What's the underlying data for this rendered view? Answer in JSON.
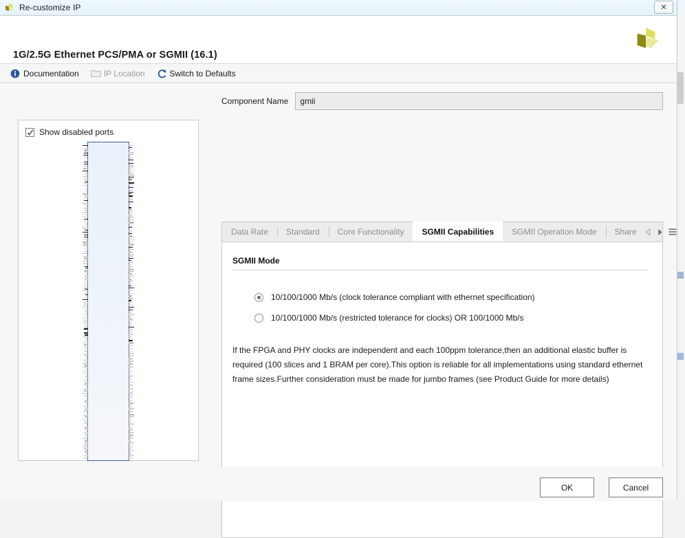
{
  "titlebar": {
    "title": "Re-customize IP",
    "logo_icon": "xilinx-logo-icon",
    "close_label": "✕"
  },
  "header": {
    "title": "1G/2.5G Ethernet PCS/PMA or SGMII (16.1)",
    "logo_icon": "xilinx-logo-icon"
  },
  "toolbar": {
    "items": [
      {
        "label": "Documentation",
        "icon": "info-icon",
        "enabled": true
      },
      {
        "label": "IP Location",
        "icon": "folder-icon",
        "enabled": false
      },
      {
        "label": "Switch to Defaults",
        "icon": "refresh-icon",
        "enabled": true
      }
    ]
  },
  "port_panel": {
    "show_disabled_ports_label": "Show disabled ports",
    "show_disabled_ports_checked": true,
    "symbol_name": "ip-block-symbol"
  },
  "component": {
    "label": "Component Name",
    "value": "gmii",
    "placeholder": "Component Name"
  },
  "tabs": {
    "items": [
      {
        "label": "Data Rate",
        "active": false
      },
      {
        "label": "Standard",
        "active": false
      },
      {
        "label": "Core Functionality",
        "active": false
      },
      {
        "label": "SGMII Capabilities",
        "active": true
      },
      {
        "label": "SGMII Operation Mode",
        "active": false
      },
      {
        "label": "Share",
        "active": false
      }
    ],
    "nav": {
      "prev_icon": "chevron-left-icon",
      "next_icon": "chevron-right-icon",
      "menu_icon": "hamburger-menu-icon"
    }
  },
  "panel": {
    "group_title": "SGMII Mode",
    "options": [
      {
        "label": "10/100/1000 Mb/s (clock tolerance compliant with ethernet specification)",
        "selected": true
      },
      {
        "label": "10/100/1000 Mb/s (restricted tolerance for clocks) OR 100/1000 Mb/s",
        "selected": false
      }
    ],
    "description": "If the FPGA and PHY clocks are independent and each 100ppm tolerance,then an additional elastic buffer is required (100 slices and 1 BRAM per core).This option is reliable for all implementations using standard ethernet frame sizes.Further consideration must be made for jumbo frames (see Product Guide for more details)"
  },
  "footer": {
    "ok_label": "OK",
    "cancel_label": "Cancel"
  },
  "colors": {
    "accent_blue": "#2a5699",
    "logo_yellow": "#c8c832",
    "logo_olive": "#8a8a14",
    "tab_active_text": "#111111",
    "tab_inactive_text": "#8d8d8d",
    "symbol_fill": "#eaf1fa",
    "symbol_border": "#41628f"
  }
}
